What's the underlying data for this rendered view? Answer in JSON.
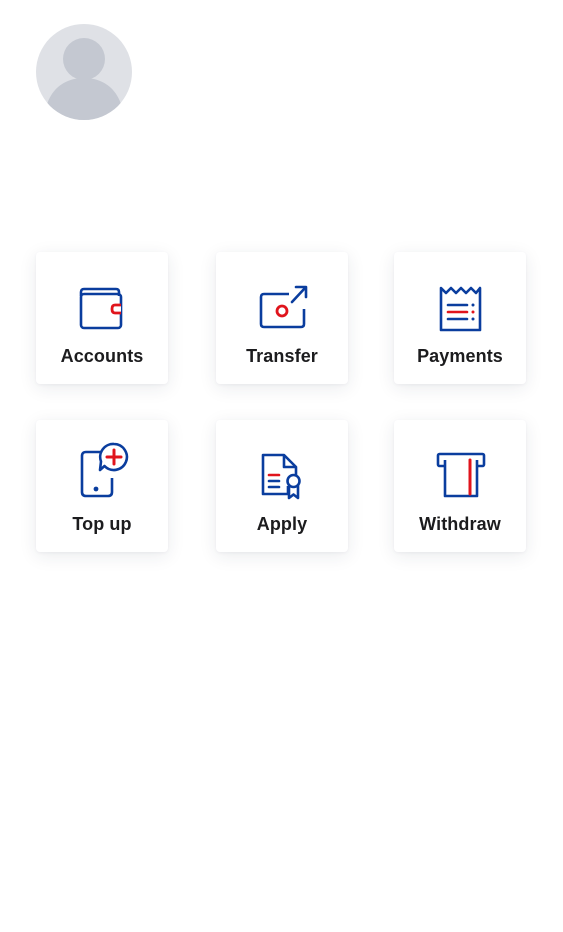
{
  "profile": {
    "avatar_icon": "user-silhouette-icon"
  },
  "colors": {
    "icon_primary": "#0a3d9e",
    "icon_accent": "#e0141c",
    "avatar_bg": "#dfe1e6",
    "avatar_figure": "#c4c8d1",
    "label_text": "#1c1c1e"
  },
  "actions": [
    {
      "label": "Accounts",
      "icon": "wallet-icon"
    },
    {
      "label": "Transfer",
      "icon": "transfer-icon"
    },
    {
      "label": "Payments",
      "icon": "receipt-icon"
    },
    {
      "label": "Top up",
      "icon": "phone-topup-icon"
    },
    {
      "label": "Apply",
      "icon": "document-certificate-icon"
    },
    {
      "label": "Withdraw",
      "icon": "atm-withdraw-icon"
    }
  ]
}
